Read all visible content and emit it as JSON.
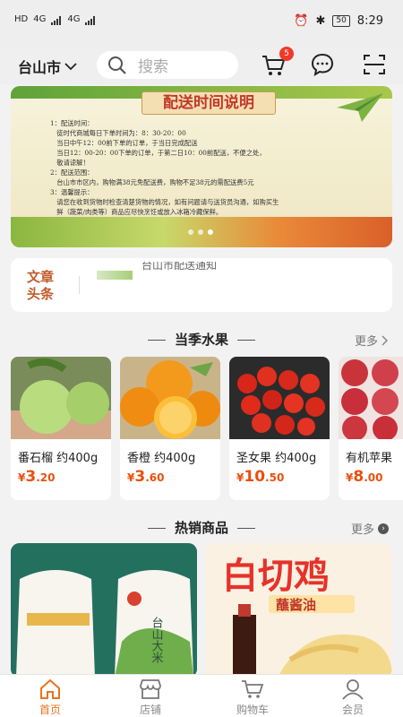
{
  "status": {
    "net1": "HD",
    "net2": "4G",
    "net3": "4G",
    "battery": "50",
    "time": "8:29"
  },
  "header": {
    "city": "台山市",
    "search_placeholder": "搜索",
    "cart_count": "5"
  },
  "banner": {
    "title": "配送时间说明",
    "lines": [
      "1：配送时间：",
      "　徒时代商城每日下单时间为：8：30-20：00",
      "　当日中午12：00前下单的订单，于当日完成配送",
      "　当日12：00-20：00下单的订单，于第二日10：00前配送，不便之处，",
      "　敬请谅解！",
      "2：配送范围：",
      "　台山市市区内，购物满38元免配送费，购物不足38元的需配送费5元",
      "3：温馨提示：",
      "　请您在收到货物时检查清楚货物的情况，如有问题请与送货员沟通，如购买生",
      "　鲜（蔬菜/肉类等）商品应尽快烹饪或放入冰箱冷藏保鲜。"
    ]
  },
  "news": {
    "tag": "文章头条",
    "text": "台山市配送通知"
  },
  "season": {
    "title": "当季水果",
    "more": "更多",
    "items": [
      {
        "name": "番石榴 约400g",
        "yen": "¥",
        "int": "3",
        "dec": ".20"
      },
      {
        "name": "香橙 约400g",
        "yen": "¥",
        "int": "3",
        "dec": ".60"
      },
      {
        "name": "圣女果 约400g",
        "yen": "¥",
        "int": "10",
        "dec": ".50"
      },
      {
        "name": "有机苹果",
        "yen": "¥",
        "int": "8",
        "dec": ".00"
      }
    ]
  },
  "hot": {
    "title": "热销商品",
    "more": "更多",
    "rice_label": "台山大米",
    "chicken_title": "白切鸡",
    "chicken_sub": "蘸酱油"
  },
  "tabs": [
    {
      "label": "首页"
    },
    {
      "label": "店铺"
    },
    {
      "label": "购物车"
    },
    {
      "label": "会员"
    }
  ],
  "colors": {
    "accent": "#e8741f",
    "price": "#e8500f",
    "badge": "#ef3a2b"
  }
}
